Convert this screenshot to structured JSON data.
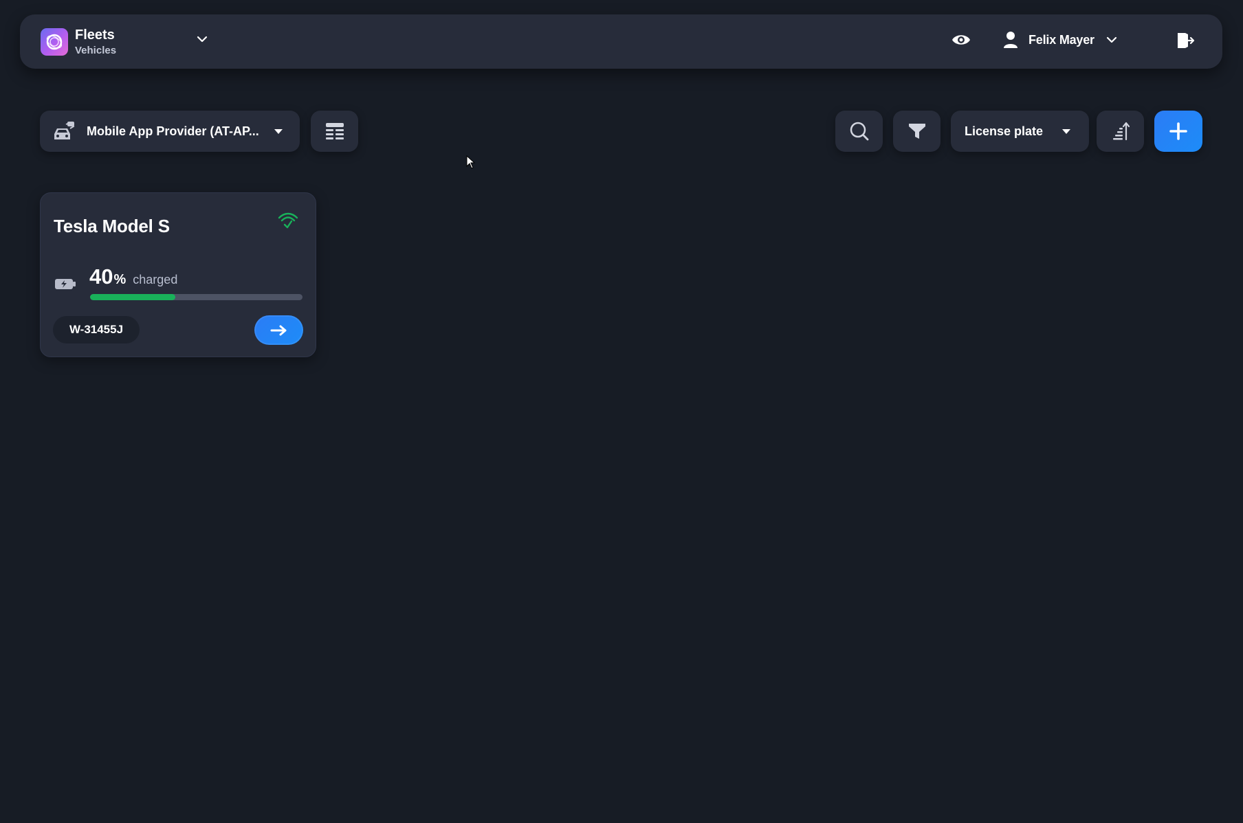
{
  "header": {
    "app_title": "Fleets",
    "app_subtitle": "Vehicles",
    "user_name": "Felix Mayer"
  },
  "toolbar": {
    "provider_label": "Mobile App Provider (AT-AP...",
    "sort_label": "License plate"
  },
  "vehicles": [
    {
      "name": "Tesla Model S",
      "charge_number": "40",
      "charge_unit": "%",
      "charge_text": "charged",
      "charge_fraction": 0.4,
      "license_plate": "W-31455J",
      "connected": true
    }
  ],
  "colors": {
    "background": "#171c25",
    "surface": "#272c3a",
    "accent_blue": "#2b7cf5",
    "charge_green": "#19b15a",
    "signal_green": "#19b15a"
  },
  "icons": [
    "brand-logo-icon",
    "chevron-down-icon",
    "eye-icon",
    "user-icon",
    "logout-icon",
    "car-icon",
    "caret-down-icon",
    "list-icon",
    "search-icon",
    "filter-icon",
    "sort-icon",
    "plus-icon",
    "signal-icon",
    "battery-icon",
    "arrow-right-icon"
  ]
}
